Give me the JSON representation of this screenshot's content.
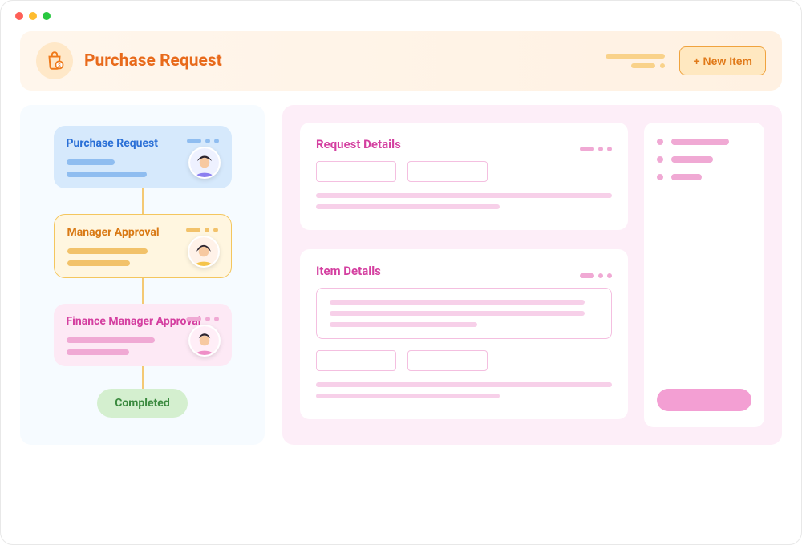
{
  "header": {
    "title": "Purchase Request",
    "new_item_label": "+ New Item"
  },
  "workflow": {
    "steps": [
      {
        "title": "Purchase Request"
      },
      {
        "title": "Manager Approval"
      },
      {
        "title": "Finance Manager Approval"
      }
    ],
    "completed_label": "Completed"
  },
  "details": {
    "request_title": "Request Details",
    "item_title": "Item Details"
  }
}
